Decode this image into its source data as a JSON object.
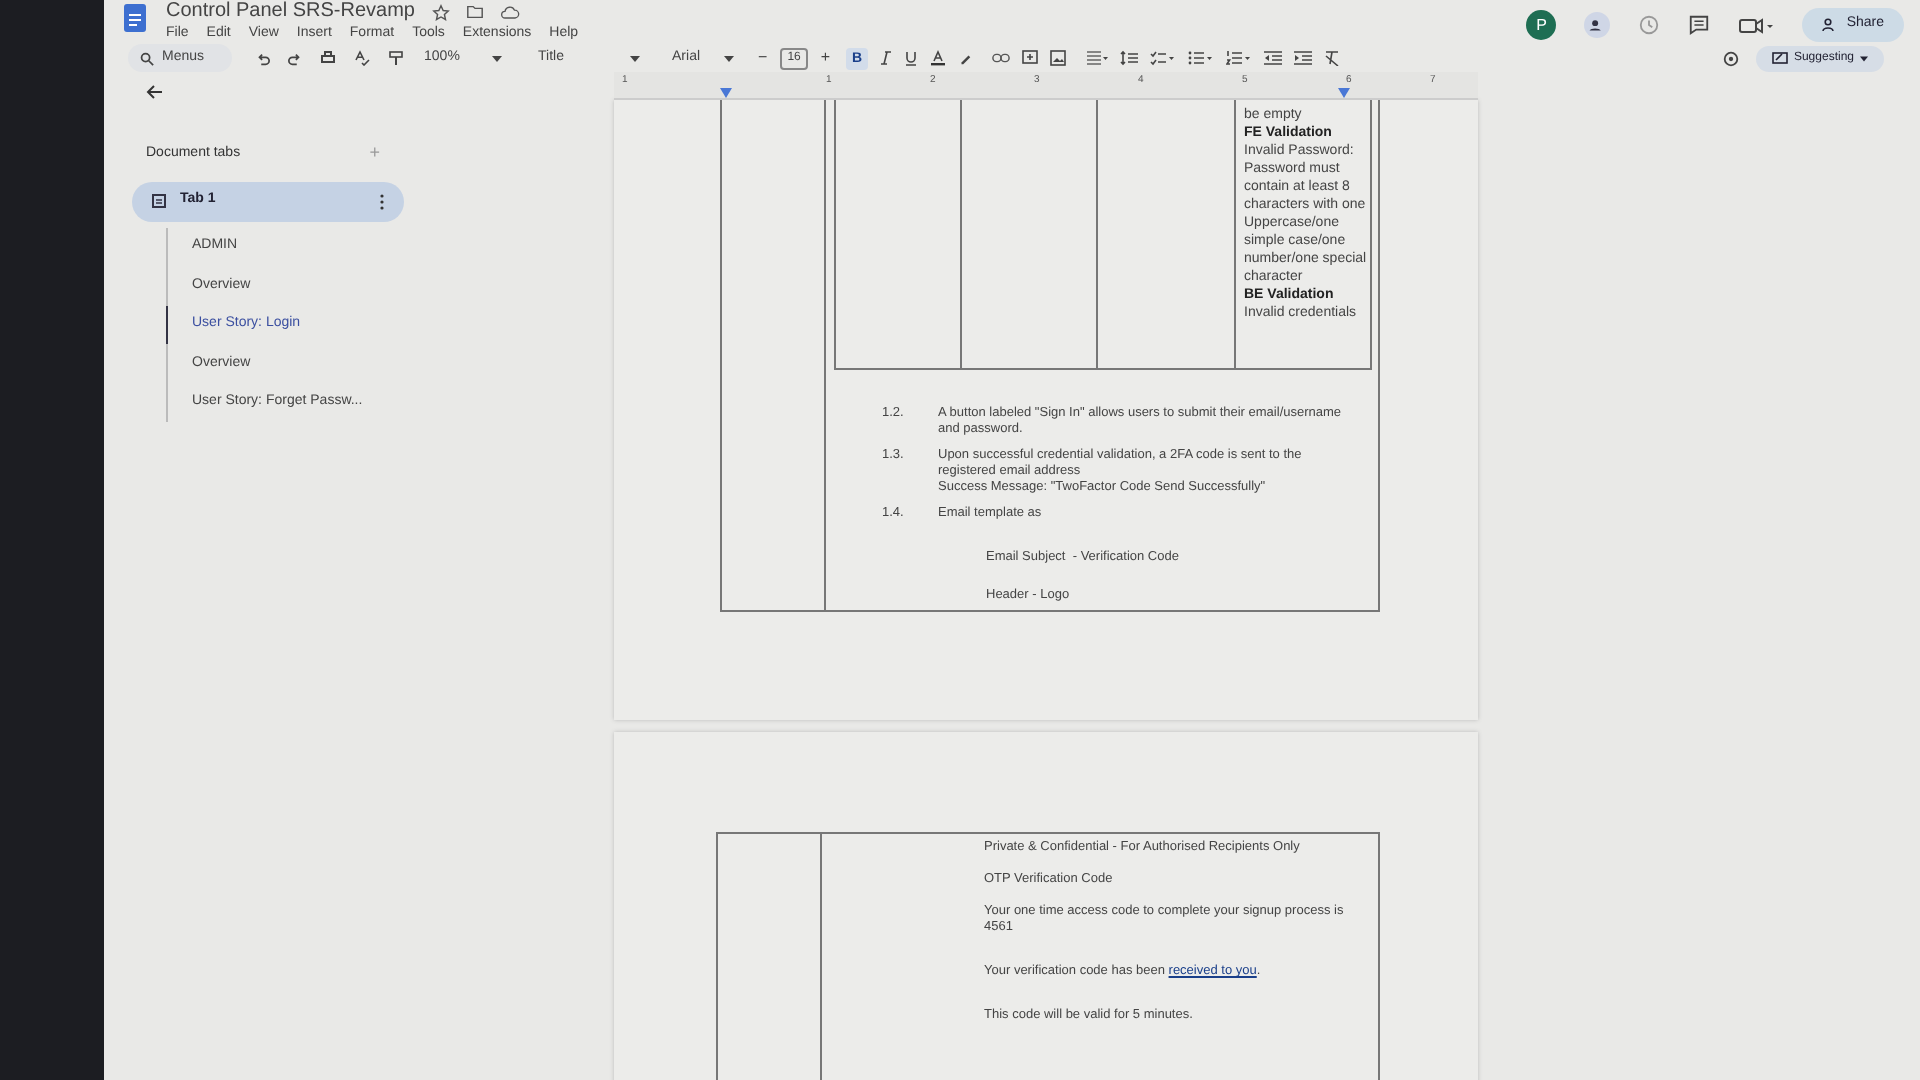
{
  "document": {
    "title": "Control Panel SRS-Revamp"
  },
  "menu": [
    "File",
    "Edit",
    "View",
    "Insert",
    "Format",
    "Tools",
    "Extensions",
    "Help"
  ],
  "toolbar": {
    "search": "Menus",
    "zoom": "100%",
    "style": "Title",
    "font": "Arial",
    "font_size": "16",
    "bold": true,
    "bold_label": "B",
    "minus": "−",
    "plus": "+"
  },
  "account": {
    "avatar": "P",
    "share": "Share",
    "mode": "Suggesting"
  },
  "ruler": [
    "1",
    "1",
    "2",
    "3",
    "4",
    "5",
    "6",
    "7"
  ],
  "sidebar": {
    "heading": "Document tabs",
    "add": "+",
    "tabs": [
      {
        "label": "Tab 1",
        "selected": true,
        "outline": [
          {
            "label": "ADMIN",
            "selected": false
          },
          {
            "label": "Overview",
            "selected": false
          },
          {
            "label": "User Story: Login",
            "selected": true
          },
          {
            "label": "Overview",
            "selected": false
          },
          {
            "label": "User Story: Forget Passw...",
            "selected": false
          }
        ]
      }
    ]
  },
  "page1": {
    "cell_lines": [
      {
        "text": "be empty",
        "bold": false
      },
      {
        "text": "FE Validation",
        "bold": true
      },
      {
        "text": "Invalid Password: Password must contain at least 8 characters with one Uppercase/one simple case/one number/one special character",
        "bold": false
      },
      {
        "text": "BE Validation",
        "bold": true
      },
      {
        "text": " Invalid credentials",
        "bold": false
      }
    ],
    "items": [
      {
        "number": "1.2.",
        "lines": [
          "A button labeled \"Sign In\" allows users to submit their email/username and password."
        ]
      },
      {
        "number": "1.3.",
        "lines": [
          "Upon successful credential validation, a 2FA code is sent to the registered email address",
          "Success Message: \"TwoFactor Code Send Successfully\""
        ]
      },
      {
        "number": "1.4.",
        "lines": [
          "Email template as"
        ]
      }
    ],
    "template_lines": [
      "Email Subject  - Verification Code",
      "Header - Logo"
    ]
  },
  "page2": {
    "email_lines": [
      {
        "text": "Private & Confidential - For Authorised Recipients Only"
      },
      {
        "text": "OTP Verification Code"
      },
      {
        "text": "Your one time access code to complete your signup process is 4561"
      },
      {
        "text": "Your verification code has been ",
        "link": "received to you",
        "after": "."
      },
      {
        "text": "This code will be valid for 5 minutes."
      }
    ]
  }
}
